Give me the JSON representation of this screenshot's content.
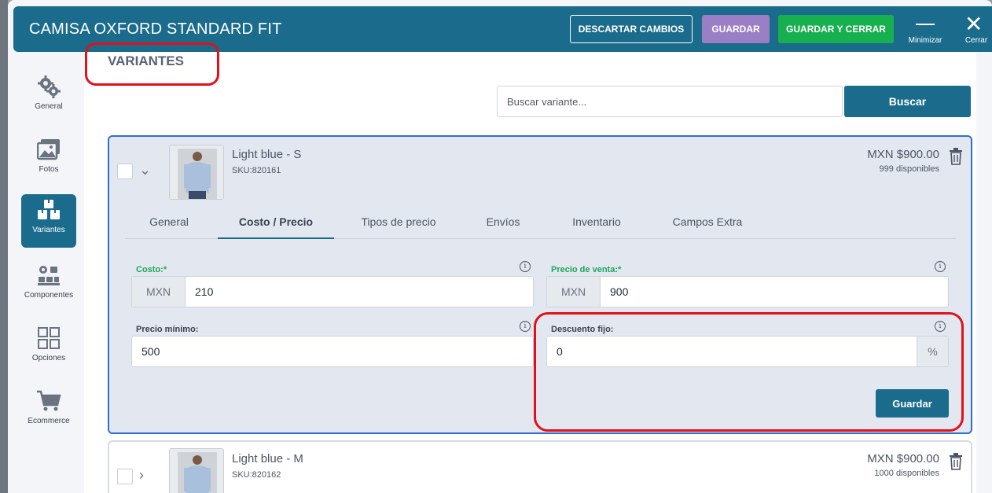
{
  "window": {
    "title": "CAMISA OXFORD STANDARD FIT",
    "discard_label": "DESCARTAR CAMBIOS",
    "save_label": "GUARDAR",
    "save_close_label": "GUARDAR Y CERRAR",
    "minimize_label": "Minimizar",
    "close_label": "Cerrar"
  },
  "sidebar": {
    "items": [
      {
        "label": "General",
        "icon": "gears-icon"
      },
      {
        "label": "Fotos",
        "icon": "photos-icon"
      },
      {
        "label": "Variantes",
        "icon": "boxes-icon",
        "active": true
      },
      {
        "label": "Componentes",
        "icon": "components-icon"
      },
      {
        "label": "Opciones",
        "icon": "grid-icon"
      },
      {
        "label": "Ecommerce",
        "icon": "cart-icon"
      }
    ]
  },
  "main": {
    "section_title": "VARIANTES",
    "search_placeholder": "Buscar variante...",
    "search_button": "Buscar"
  },
  "variants": [
    {
      "name": "Light blue - S",
      "sku": "SKU:820161",
      "price": "MXN $900.00",
      "stock": "999 disponibles",
      "expanded": true
    },
    {
      "name": "Light blue - M",
      "sku": "SKU:820162",
      "price": "MXN $900.00",
      "stock": "1000 disponibles",
      "expanded": false
    }
  ],
  "tabs": [
    "General",
    "Costo / Precio",
    "Tipos de precio",
    "Envíos",
    "Inventario",
    "Campos Extra"
  ],
  "active_tab": "Costo / Precio",
  "form": {
    "cost_label": "Costo:*",
    "cost_currency": "MXN",
    "cost_value": "210",
    "sale_price_label": "Precio de venta:*",
    "sale_currency": "MXN",
    "sale_value": "900",
    "min_price_label": "Precio mínimo:",
    "min_price_value": "500",
    "discount_label": "Descuento fijo:",
    "discount_value": "0",
    "discount_suffix": "%",
    "save_button": "Guardar"
  },
  "colors": {
    "brand": "#1b6b8c",
    "save_purple": "#9b7fc6",
    "save_close_green": "#17b04f",
    "required_green": "#1fa55c",
    "annotation_red": "#e3101a",
    "selected_card_border": "#2d6fd6"
  }
}
